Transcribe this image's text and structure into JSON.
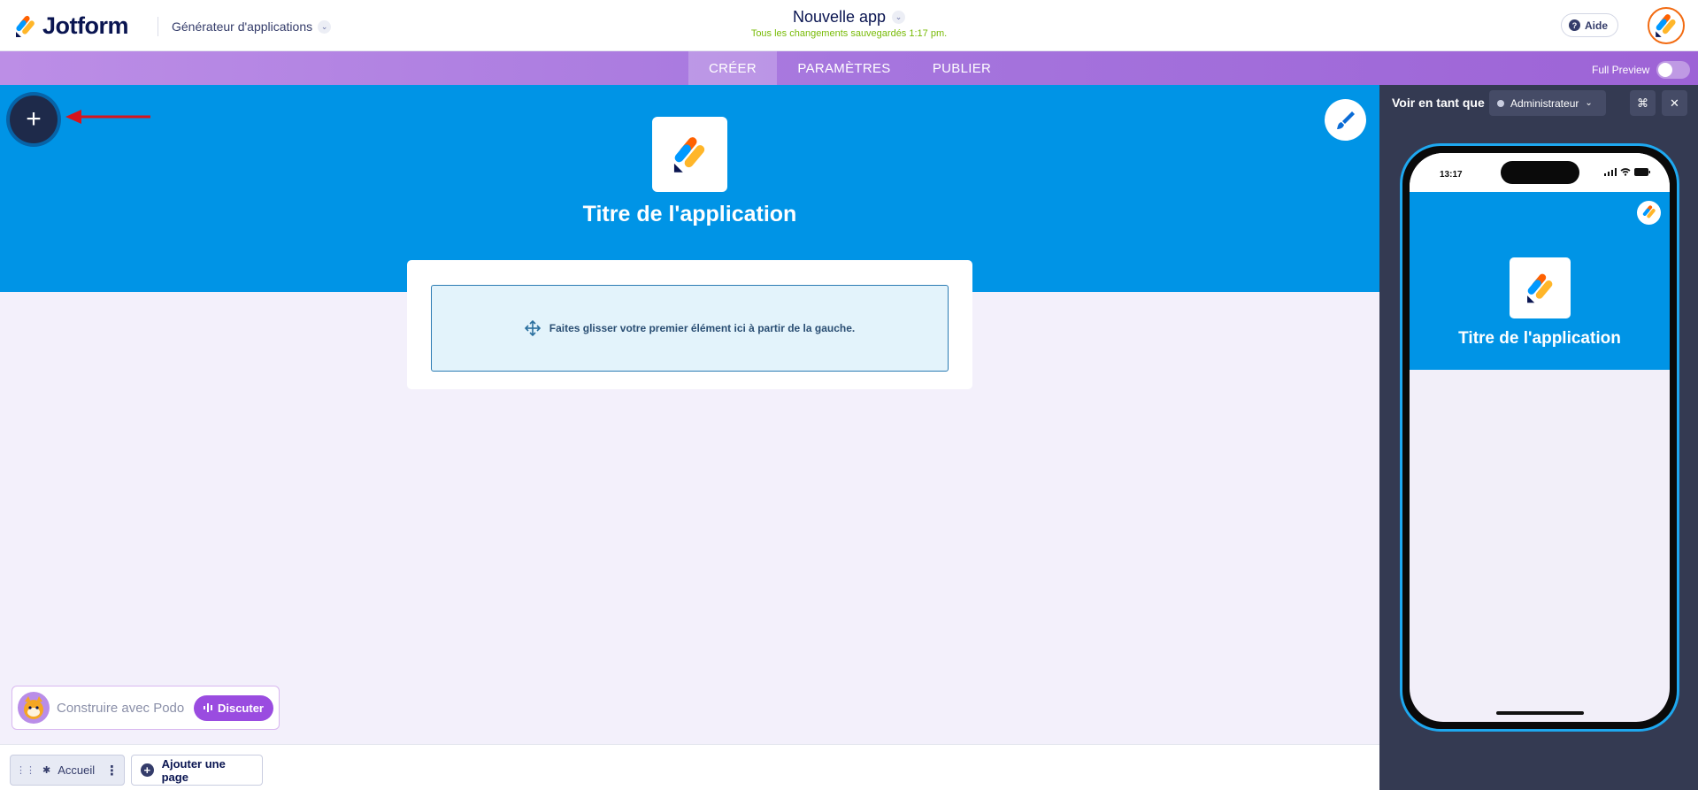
{
  "brand": {
    "name": "Jotform"
  },
  "header": {
    "builder_label": "Générateur d'applications",
    "app_name": "Nouvelle app",
    "save_status": "Tous les changements sauvegardés 1:17 pm.",
    "help_label": "Aide"
  },
  "nav": {
    "tabs": [
      {
        "label": "CRÉER",
        "active": true
      },
      {
        "label": "PARAMÈTRES",
        "active": false
      },
      {
        "label": "PUBLIER",
        "active": false
      }
    ],
    "full_preview_label": "Full Preview",
    "full_preview_on": false
  },
  "canvas": {
    "add_button_label": "+",
    "app_title": "Titre de l'application",
    "dropzone_text": "Faites glisser votre premier élément ici à partir de la gauche.",
    "hero_color": "#0094e6"
  },
  "podo": {
    "placeholder": "Construire avec Podo",
    "button_label": "Discuter"
  },
  "pages": {
    "items": [
      {
        "label": "Accueil"
      }
    ],
    "add_page_label": "Ajouter une page"
  },
  "preview": {
    "view_as_label": "Voir en tant que",
    "role": "Administrateur",
    "phone": {
      "time": "13:17",
      "app_title": "Titre de l'application"
    }
  },
  "colors": {
    "accent_purple": "#9a4ce0",
    "hero_blue": "#0094e6",
    "save_green": "#78bb07",
    "preview_panel": "#343a52"
  }
}
